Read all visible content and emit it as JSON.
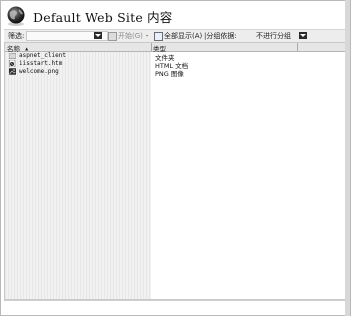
{
  "header": {
    "title": "Default Web Site 内容",
    "icon": "globe-icon"
  },
  "toolbar": {
    "filter_label": "筛选:",
    "filter_value": "",
    "start_label": "开始(G)",
    "start_arrow": "-",
    "show_all_label": "全部显示(A)",
    "group_by_label": "分组依据:",
    "group_by_value": "不进行分组"
  },
  "columns": {
    "name_label": "名称",
    "name_sort": "▲",
    "type_label": "类型"
  },
  "rows": [
    {
      "name": "aspnet_client",
      "type": "文件夹",
      "icon": "folder-icon"
    },
    {
      "name": "iisstart.htm",
      "type": "HTML 文档",
      "icon": "html-file-icon"
    },
    {
      "name": "welcome.png",
      "type": "PNG 图像",
      "icon": "image-file-icon"
    }
  ],
  "colors": {
    "toolbar_bg": "#ededed",
    "header_bg": "#e6e6e6",
    "name_column_bg": "#f2f2f2"
  }
}
